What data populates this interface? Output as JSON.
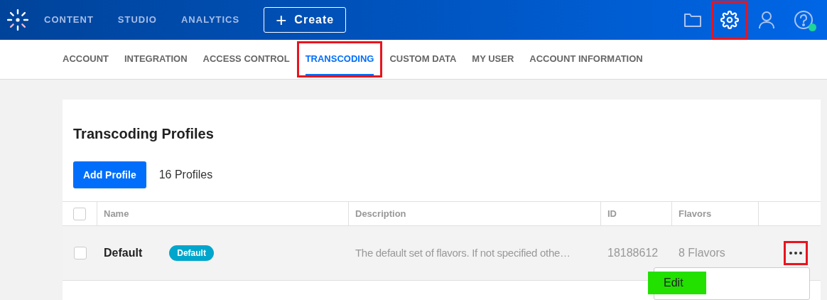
{
  "top_nav": {
    "items": [
      {
        "label": "CONTENT"
      },
      {
        "label": "STUDIO"
      },
      {
        "label": "ANALYTICS"
      }
    ],
    "create_button": {
      "icon": "+",
      "label": "Create"
    },
    "icons": [
      {
        "kind": "folder",
        "highlighted": false
      },
      {
        "kind": "settings",
        "highlighted": true
      },
      {
        "kind": "user",
        "highlighted": false
      },
      {
        "kind": "help",
        "highlighted": false,
        "status_dot": true
      }
    ]
  },
  "tabs": [
    {
      "label": "ACCOUNT",
      "selected": false,
      "highlighted": false
    },
    {
      "label": "INTEGRATION",
      "selected": false,
      "highlighted": false
    },
    {
      "label": "ACCESS CONTROL",
      "selected": false,
      "highlighted": false
    },
    {
      "label": "TRANSCODING",
      "selected": true,
      "highlighted": true
    },
    {
      "label": "CUSTOM DATA",
      "selected": false,
      "highlighted": false
    },
    {
      "label": "MY USER",
      "selected": false,
      "highlighted": false
    },
    {
      "label": "ACCOUNT INFORMATION",
      "selected": false,
      "highlighted": false
    }
  ],
  "panel": {
    "title": "Transcoding Profiles",
    "add_button": "Add Profile",
    "count": "16 Profiles",
    "table": {
      "columns": [
        "Name",
        "Description",
        "ID",
        "Flavors"
      ],
      "header_checked": false,
      "rows": [
        {
          "checked": false,
          "name": "Default",
          "badge": "Default",
          "description": "The default set of flavors. If not specified othe…",
          "id": "18188612",
          "flavors": "8 Flavors",
          "menu_highlighted": true
        }
      ]
    },
    "menu": {
      "items": [
        {
          "label": "Edit",
          "highlighted": true
        }
      ]
    }
  }
}
